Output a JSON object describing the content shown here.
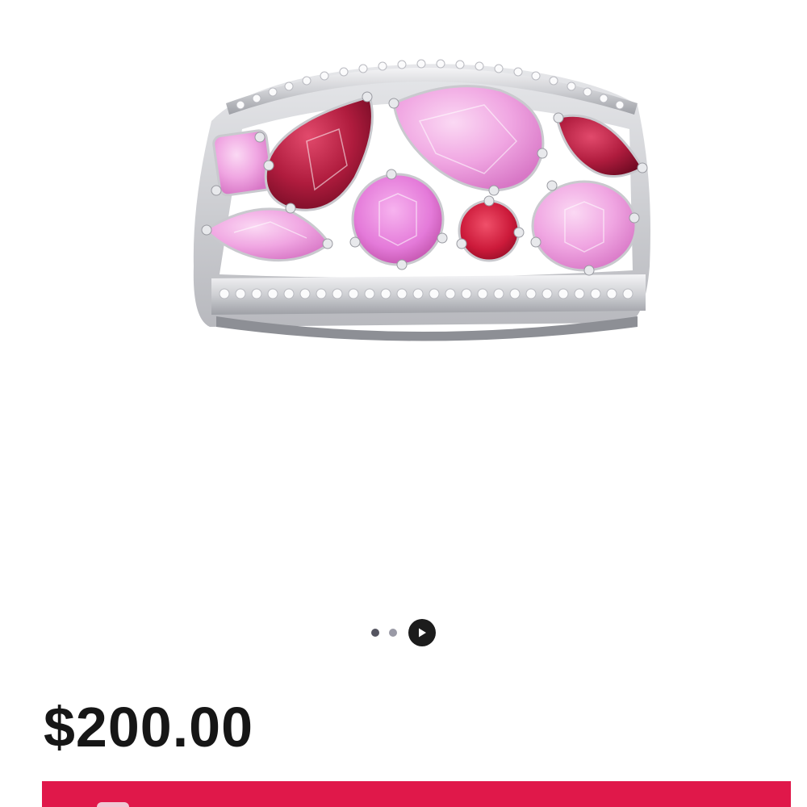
{
  "product": {
    "image_description_icon": "ring-product-image",
    "price": "$200.00"
  },
  "carousel": {
    "dots": [
      {
        "state": "active"
      },
      {
        "state": "inactive"
      }
    ],
    "play_icon": "play-icon"
  },
  "colors": {
    "accent": "#e0184a",
    "price_text": "#161616",
    "dot_active": "#555560",
    "dot_inactive": "#9a9aa6"
  }
}
